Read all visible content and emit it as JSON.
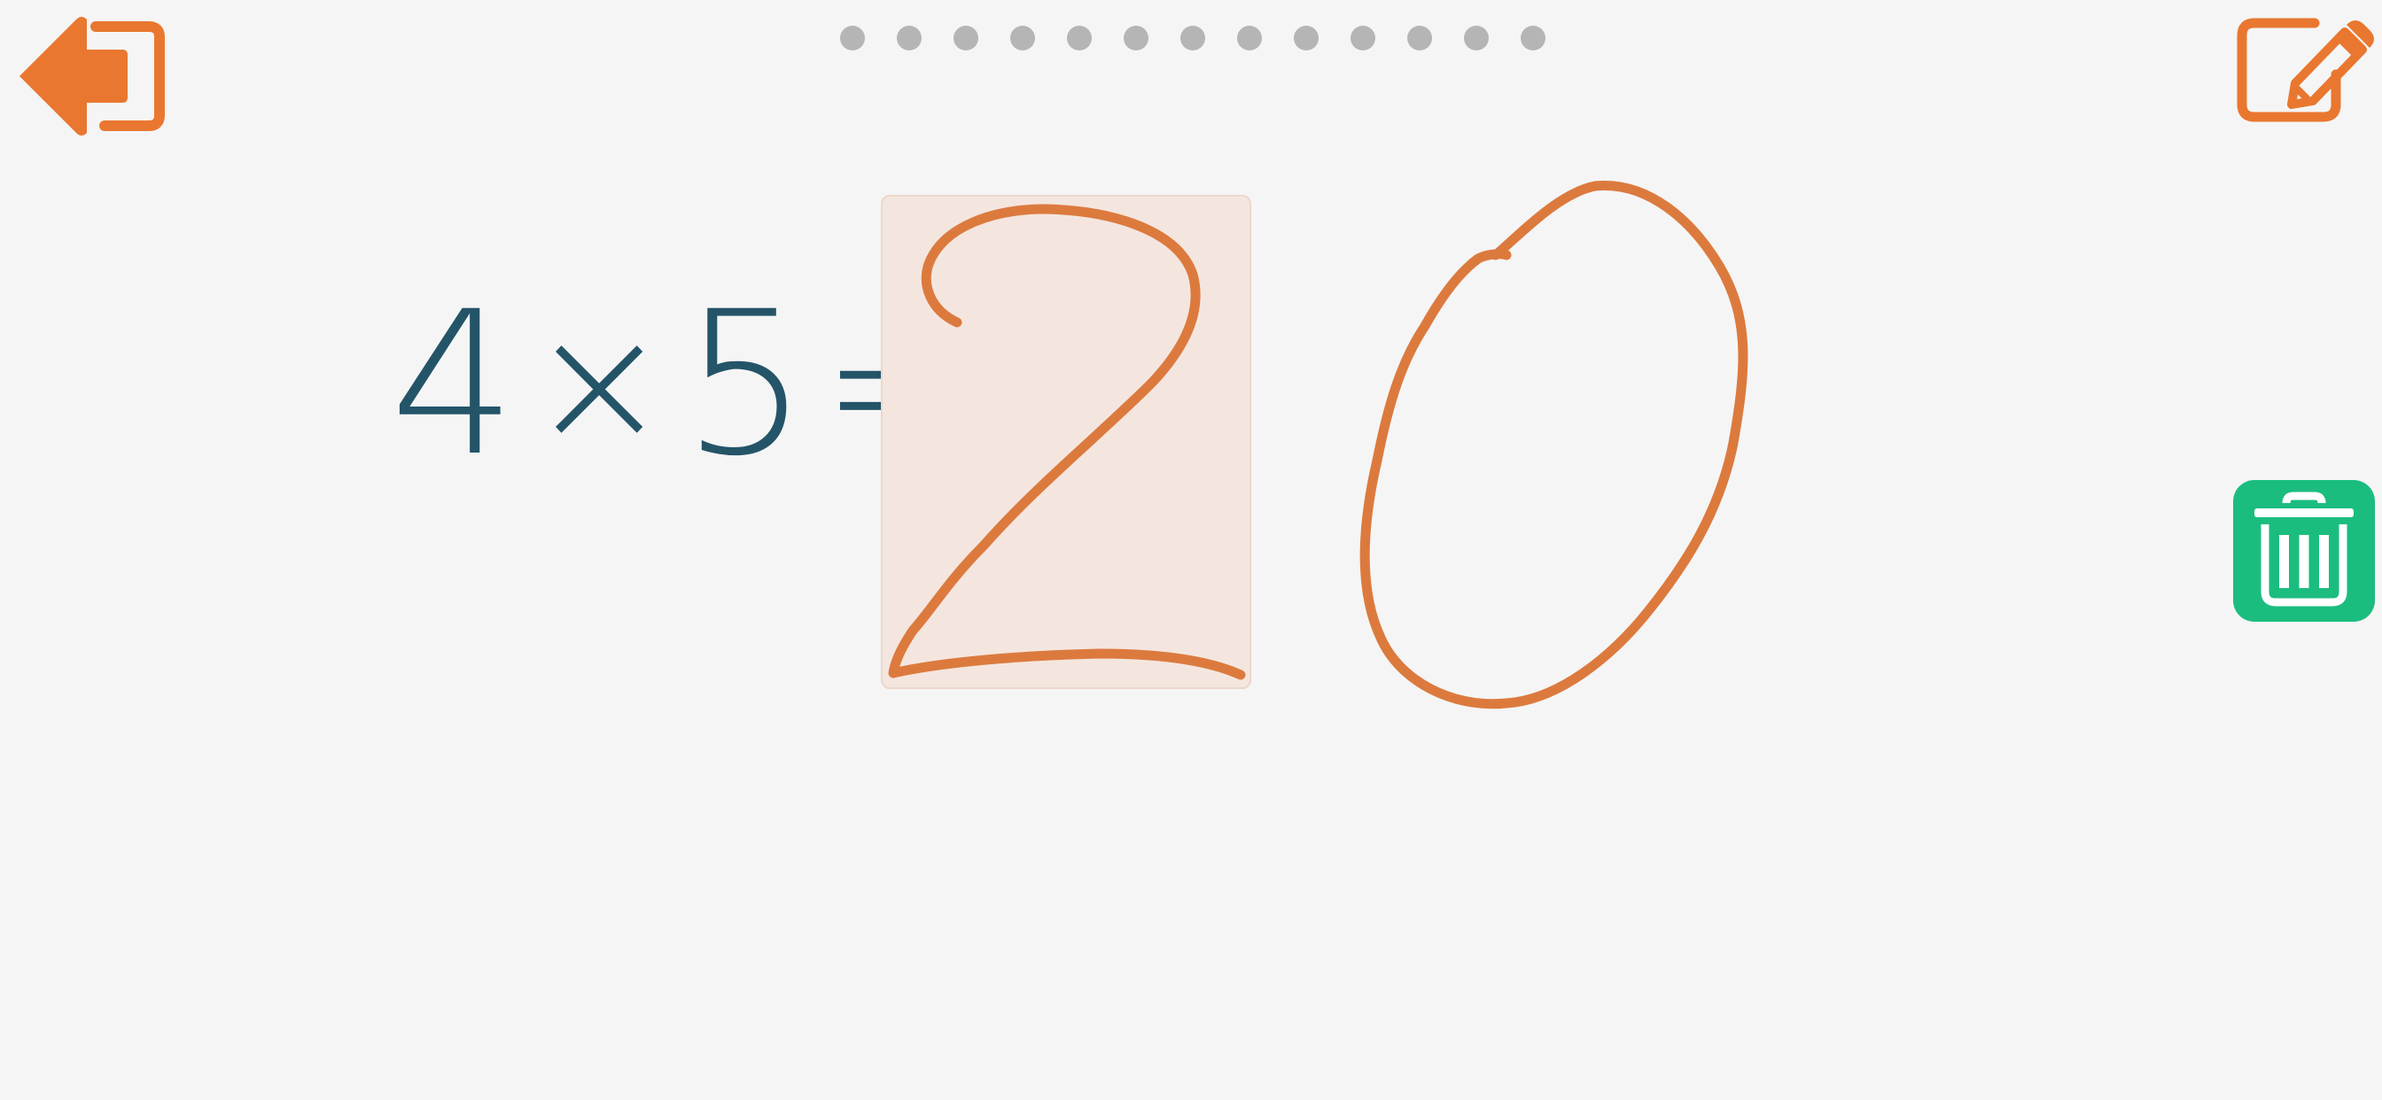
{
  "header": {
    "exit_icon": "exit-arrow-icon",
    "edit_icon": "pencil-square-icon",
    "progress": {
      "total_steps": 13,
      "current_step": 1
    }
  },
  "problem": {
    "operand_a": "4",
    "operator": "×",
    "operand_b": "5",
    "equals": "=",
    "answer_digit": "2"
  },
  "handwriting": {
    "strokes": [
      "2",
      "0"
    ]
  },
  "sidebar": {
    "trash_icon": "trash-icon"
  },
  "colors": {
    "accent_orange": "#e9772f",
    "problem_text": "#245468",
    "answer_red": "#e8141e",
    "ink": "#dc7a3e",
    "trash_green": "#1bbd7f",
    "dot_gray": "#b5b5b5",
    "background": "#f5f5f5"
  }
}
